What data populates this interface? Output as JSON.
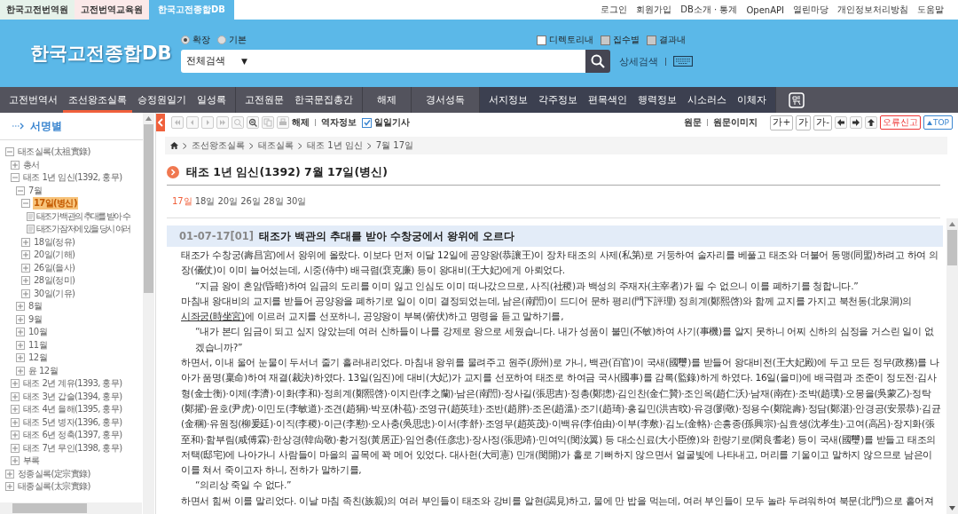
{
  "site_tabs": [
    {
      "label": "한국고전번역원",
      "color": "#e6f2ea",
      "selected": false
    },
    {
      "label": "고전번역교육원",
      "color": "#fbe9e9",
      "selected": false
    },
    {
      "label": "한국고전종합DB",
      "color": "#5bb8e8",
      "selected": true
    }
  ],
  "top_links": [
    "로그인",
    "회원가입",
    "DB소개 · 통계",
    "OpenAPI",
    "열린마당",
    "개인정보처리방침",
    "도움말"
  ],
  "logo": "한국고전종합DB",
  "search": {
    "modes": [
      {
        "label": "확장",
        "selected": true
      },
      {
        "label": "기본",
        "selected": false
      }
    ],
    "filters": [
      {
        "label": "디렉토리내",
        "checked": false,
        "disabled": false
      },
      {
        "label": "집수별",
        "checked": false,
        "disabled": true
      },
      {
        "label": "결과내",
        "checked": false,
        "disabled": true
      }
    ],
    "scope": "전체검색",
    "caret": "▼",
    "advanced": "상세검색"
  },
  "nav": [
    {
      "kind": "light",
      "items": [
        {
          "label": "고전번역서",
          "selected": false
        },
        {
          "label": "조선왕조실록",
          "selected": true
        },
        {
          "label": "승정원일기",
          "selected": false
        },
        {
          "label": "일성록",
          "selected": false
        }
      ]
    },
    {
      "kind": "light",
      "items": [
        {
          "label": "고전원문",
          "selected": false
        },
        {
          "label": "한국문집총간",
          "selected": false
        }
      ]
    },
    {
      "kind": "light",
      "items": [
        {
          "label": "해제",
          "selected": false
        }
      ]
    },
    {
      "kind": "light",
      "items": [
        {
          "label": "경서성독",
          "selected": false
        }
      ]
    },
    {
      "kind": "dark",
      "items": [
        {
          "label": "서지정보",
          "selected": false
        },
        {
          "label": "각주정보",
          "selected": false
        },
        {
          "label": "편목색인",
          "selected": false
        },
        {
          "label": "행력정보",
          "selected": false
        },
        {
          "label": "시소러스",
          "selected": false
        },
        {
          "label": "이체자",
          "selected": false
        }
      ]
    }
  ],
  "sidebar": {
    "title": "서명별",
    "tree": [
      {
        "label": "태조실록(太祖實錄)",
        "kind": "folder",
        "expanded": true,
        "selected": false,
        "children": [
          {
            "label": "총서",
            "kind": "folder",
            "expanded": false,
            "selected": false
          },
          {
            "label": "태조 1년 임신(1392, 홍무)",
            "kind": "folder",
            "expanded": true,
            "selected": false,
            "children": [
              {
                "label": "7월",
                "kind": "folder",
                "expanded": true,
                "selected": false,
                "children": [
                  {
                    "label": "17일(병신)",
                    "kind": "folder",
                    "expanded": true,
                    "selected": true,
                    "children": [
                      {
                        "label": "태조가 백관의 추대를 받아 수",
                        "kind": "doc",
                        "selected": false
                      },
                      {
                        "label": "태조가 잠저에 있을 당시 여러",
                        "kind": "doc",
                        "selected": false
                      }
                    ]
                  },
                  {
                    "label": "18일(정유)",
                    "kind": "folder",
                    "expanded": false,
                    "selected": false
                  },
                  {
                    "label": "20일(기해)",
                    "kind": "folder",
                    "expanded": false,
                    "selected": false
                  },
                  {
                    "label": "26일(을사)",
                    "kind": "folder",
                    "expanded": false,
                    "selected": false
                  },
                  {
                    "label": "28일(정미)",
                    "kind": "folder",
                    "expanded": false,
                    "selected": false
                  },
                  {
                    "label": "30일(기유)",
                    "kind": "folder",
                    "expanded": false,
                    "selected": false
                  }
                ]
              },
              {
                "label": "8월",
                "kind": "folder",
                "expanded": false,
                "selected": false
              },
              {
                "label": "9월",
                "kind": "folder",
                "expanded": false,
                "selected": false
              },
              {
                "label": "10월",
                "kind": "folder",
                "expanded": false,
                "selected": false
              },
              {
                "label": "11월",
                "kind": "folder",
                "expanded": false,
                "selected": false
              },
              {
                "label": "12월",
                "kind": "folder",
                "expanded": false,
                "selected": false
              },
              {
                "label": "윤 12월",
                "kind": "folder",
                "expanded": false,
                "selected": false
              }
            ]
          },
          {
            "label": "태조 2년 계유(1393, 홍무)",
            "kind": "folder",
            "expanded": false,
            "selected": false
          },
          {
            "label": "태조 3년 갑술(1394, 홍무)",
            "kind": "folder",
            "expanded": false,
            "selected": false
          },
          {
            "label": "태조 4년 을해(1395, 홍무)",
            "kind": "folder",
            "expanded": false,
            "selected": false
          },
          {
            "label": "태조 5년 병자(1396, 홍무)",
            "kind": "folder",
            "expanded": false,
            "selected": false
          },
          {
            "label": "태조 6년 정축(1397, 홍무)",
            "kind": "folder",
            "expanded": false,
            "selected": false
          },
          {
            "label": "태조 7년 무인(1398, 홍무)",
            "kind": "folder",
            "expanded": false,
            "selected": false
          },
          {
            "label": "부록",
            "kind": "folder",
            "expanded": false,
            "selected": false
          }
        ]
      },
      {
        "label": "정종실록(定宗實錄)",
        "kind": "folder",
        "expanded": false,
        "selected": false
      },
      {
        "label": "태종실록(太宗實錄)",
        "kind": "folder",
        "expanded": false,
        "selected": false
      }
    ]
  },
  "toolbar": {
    "left_links": [
      "해제",
      "역자정보"
    ],
    "daily": {
      "label": "일일기사",
      "checked": true
    },
    "right_links": [
      "원문",
      "원문이미지"
    ],
    "font_buttons": [
      "가+",
      "가",
      "가-"
    ],
    "report": "오류신고",
    "top": "TOP"
  },
  "breadcrumb": [
    "조선왕조실록",
    "태조실록",
    "태조 1년 임신",
    "7월 17일"
  ],
  "title": "태조 1년 임신(1392) 7월 17일(병신)",
  "days": [
    {
      "label": "17일",
      "selected": true
    },
    {
      "label": "18일",
      "selected": false
    },
    {
      "label": "20일",
      "selected": false
    },
    {
      "label": "26일",
      "selected": false
    },
    {
      "label": "28일",
      "selected": false
    },
    {
      "label": "30일",
      "selected": false
    }
  ],
  "article": {
    "code": "01-07-17[01]",
    "heading": "태조가 백관의 추대를 받아 수창궁에서 왕위에 오르다",
    "paragraphs": [
      {
        "kind": "narrative",
        "segments": [
          {
            "kind": "text",
            "text": "태조가 수창궁(壽昌宮)에서 왕위에 올랐다. 이보다 먼저 이달 12일에 공양왕(恭讓王)이 장차 태조의 사제(私第)로 거둥하여 술자리를 베풀고 태조와 더불어 동맹(同盟)하려고 하여 의장(儀仗)이 이미 늘어섰는데, 시중(侍中) 배극렴(裵克廉) 등이 왕대비(王大妃)에게 아뢰었다."
          }
        ]
      },
      {
        "kind": "quote",
        "segments": [
          {
            "kind": "text",
            "text": "“지금 왕이 혼암(昏暗)하여 임금의 도리를 이미 잃고 인심도 이미 떠나갔으므로, 사직(社稷)과 백성의 주재자(主宰者)가 될 수 없으니 이를 폐하기를 청합니다.”"
          }
        ]
      },
      {
        "kind": "narrative",
        "segments": [
          {
            "kind": "text",
            "text": "마침내 왕대비의 교지를 받들어 공양왕을 폐하기로 일이 이미 결정되었는데, 남은(南誾)이 드디어 문하 평리(門下評理) 정희계(鄭熙啓)와 함께 교지를 가지고 북천동(北泉洞)의 "
          },
          {
            "kind": "link",
            "text": "시좌궁(時坐宮)"
          },
          {
            "kind": "text",
            "text": "에 이르러 교지를 선포하니, 공양왕이 부복(俯伏)하고 명령을 듣고 말하기를,"
          }
        ]
      },
      {
        "kind": "quote",
        "segments": [
          {
            "kind": "text",
            "text": "“내가 본디 임금이 되고 싶지 않았는데 여러 신하들이 나를 강제로 왕으로 세웠습니다. 내가 성품이 불민(不敏)하여 사기(事機)를 알지 못하니 어찌 신하의 심정을 거스린 일이 없겠습니까?”"
          }
        ]
      },
      {
        "kind": "narrative",
        "segments": [
          {
            "kind": "text",
            "text": "하면서, 이내 울어 눈물이 두서너 줄기 흘러내리었다. 마침내 왕위를 물려주고 원주(原州)로 가니, 백관(百官)이 국새(國璽)를 받들어 왕대비전(王大妃殿)에 두고 모든 정무(政務)를 나아가 품명(稟命)하여 재결(裁決)하였다. 13일(임진)에 대비(大妃)가 교지를 선포하여 태조로 하여금 국사(國事)를 감록(監錄)하게 하였다. 16일(을미)에 배극렴과 조준이 정도전·김사형(金士衡)·이제(李濟)·이화(李和)·정희계(鄭熙啓)·이지란(李之蘭)·남은(南誾)·장사길(張思吉)·정총(鄭摠)·김인찬(金仁贊)·조인옥(趙仁沃)·남재(南在)·조박(趙璞)·오몽을(吳蒙乙)·정탁(鄭擢)·윤호(尹虎)·이민도(李敏道)·조견(趙狷)·박포(朴苞)·조영규(趙英珪)·조반(趙胖)·조온(趙溫)·조기(趙琦)·홍길민(洪吉旼)·유경(劉敬)·정용수(鄭龍壽)·정담(鄭湛)·안경공(安景恭)·김균(金稛)·유원정(柳爰廷)·이직(李稷)·이근(李懃)·오사충(吳思忠)·이서(李舒)·조영무(趙英茂)·이백유(李伯由)·이부(李敷)·김노(金輅)·손흥종(孫興宗)·심효생(沈孝生)·고여(高呂)·장지화(張至和)·함부림(咸傅霖)·한상경(韓尙敬)·황거정(黃居正)·임언충(任彦忠)·장사정(張思靖)·민여익(閔汝翼) 등 대소신료(大小臣僚)와 한량기로(閑良耆老) 등이 국새(國璽)를 받들고 태조의 저택(邸宅)에 나아가니 사람들이 마을의 골목에 꽉 메어 있었다. 대사헌(大司憲) 민개(閔開)가 홀로 기뻐하지 않으면서 얼굴빛에 나타내고, 머리를 기울이고 말하지 않으므로 남은이 이를 쳐서 죽이고자 하니, 전하가 말하기를,"
          }
        ]
      },
      {
        "kind": "quote",
        "segments": [
          {
            "kind": "text",
            "text": "“의리상 죽일 수 없다.”"
          }
        ]
      },
      {
        "kind": "narrative",
        "segments": [
          {
            "kind": "text",
            "text": "하면서 힘써 이를 말리었다. 이날 마침 족친(族親)의 여러 부인들이 태조와 강비를 알현(謁見)하고, 물에 만 밥을 먹는데, 여러 부인들이 모두 놀라 두려워하여 북문(北門)으로 흩어져"
          }
        ]
      }
    ]
  }
}
